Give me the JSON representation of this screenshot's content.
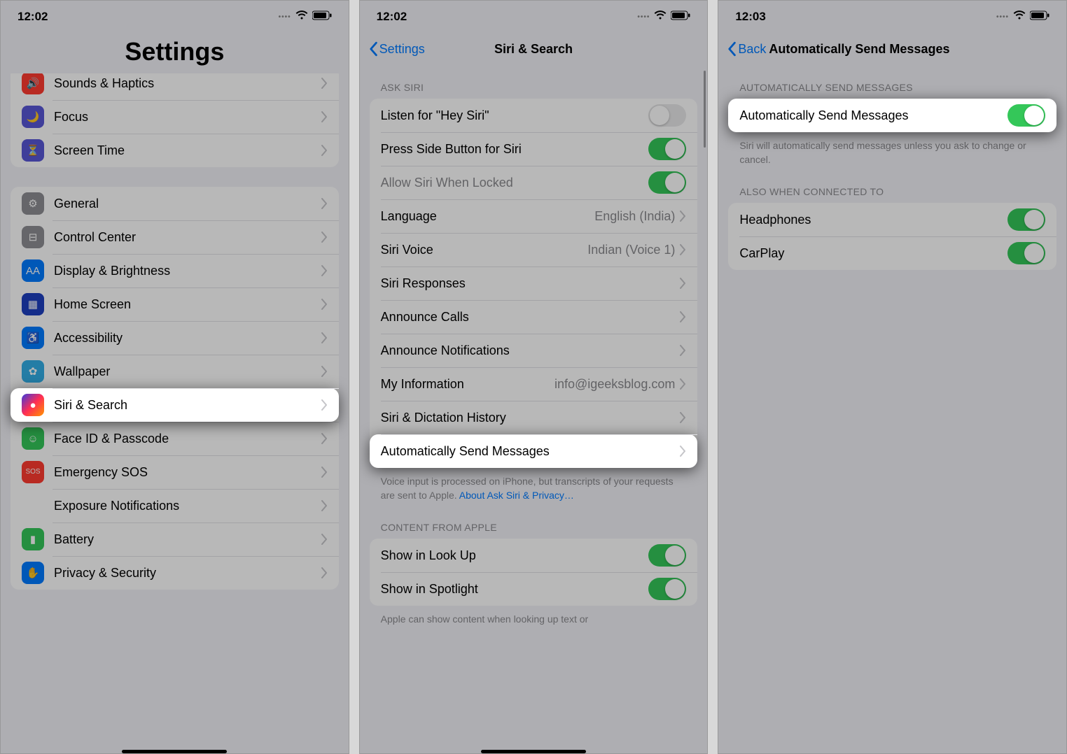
{
  "panel1": {
    "time": "12:02",
    "title": "Settings",
    "rows_g1": [
      {
        "label": "Sounds & Haptics",
        "icon": "sounds-icon",
        "bg": "bg-red",
        "glyph": "🔊"
      },
      {
        "label": "Focus",
        "icon": "focus-icon",
        "bg": "bg-indigo",
        "glyph": "🌙"
      },
      {
        "label": "Screen Time",
        "icon": "screentime-icon",
        "bg": "bg-indigo",
        "glyph": "⏳"
      }
    ],
    "rows_g2": [
      {
        "label": "General",
        "icon": "general-icon",
        "bg": "bg-gray",
        "glyph": "⚙"
      },
      {
        "label": "Control Center",
        "icon": "control-center-icon",
        "bg": "bg-gray",
        "glyph": "⊟"
      },
      {
        "label": "Display & Brightness",
        "icon": "display-icon",
        "bg": "bg-blue",
        "glyph": "AA"
      },
      {
        "label": "Home Screen",
        "icon": "home-screen-icon",
        "bg": "bg-darkblue",
        "glyph": "▦"
      },
      {
        "label": "Accessibility",
        "icon": "accessibility-icon",
        "bg": "bg-blue",
        "glyph": "♿"
      },
      {
        "label": "Wallpaper",
        "icon": "wallpaper-icon",
        "bg": "bg-cyan",
        "glyph": "✿"
      },
      {
        "label": "Siri & Search",
        "icon": "siri-icon",
        "bg": "bg-siri",
        "glyph": "●",
        "highlight": true
      },
      {
        "label": "Face ID & Passcode",
        "icon": "faceid-icon",
        "bg": "bg-green",
        "glyph": "☺"
      },
      {
        "label": "Emergency SOS",
        "icon": "sos-icon",
        "bg": "bg-red",
        "glyph": "SOS"
      },
      {
        "label": "Exposure Notifications",
        "icon": "exposure-icon",
        "bg": "bg-white-red",
        "glyph": "✺"
      },
      {
        "label": "Battery",
        "icon": "battery-icon",
        "bg": "bg-green",
        "glyph": "▮"
      },
      {
        "label": "Privacy & Security",
        "icon": "privacy-icon",
        "bg": "bg-blue",
        "glyph": "✋"
      }
    ]
  },
  "panel2": {
    "time": "12:02",
    "back": "Settings",
    "title": "Siri & Search",
    "section1": "ASK SIRI",
    "rows1": [
      {
        "label": "Listen for \"Hey Siri\"",
        "type": "toggle",
        "on": false
      },
      {
        "label": "Press Side Button for Siri",
        "type": "toggle",
        "on": true
      },
      {
        "label": "Allow Siri When Locked",
        "type": "toggle",
        "on": true,
        "disabled": true
      },
      {
        "label": "Language",
        "type": "nav",
        "value": "English (India)"
      },
      {
        "label": "Siri Voice",
        "type": "nav",
        "value": "Indian (Voice 1)"
      },
      {
        "label": "Siri Responses",
        "type": "nav"
      },
      {
        "label": "Announce Calls",
        "type": "nav"
      },
      {
        "label": "Announce Notifications",
        "type": "nav"
      },
      {
        "label": "My Information",
        "type": "nav",
        "value": "info@igeeksblog.com"
      },
      {
        "label": "Siri & Dictation History",
        "type": "nav"
      },
      {
        "label": "Automatically Send Messages",
        "type": "nav",
        "highlight": true
      }
    ],
    "footer1_a": "Voice input is processed on iPhone, but transcripts of your requests are sent to Apple. ",
    "footer1_link": "About Ask Siri & Privacy…",
    "section2": "CONTENT FROM APPLE",
    "rows2": [
      {
        "label": "Show in Look Up",
        "type": "toggle",
        "on": true
      },
      {
        "label": "Show in Spotlight",
        "type": "toggle",
        "on": true
      }
    ],
    "footer2": "Apple can show content when looking up text or"
  },
  "panel3": {
    "time": "12:03",
    "back": "Back",
    "title": "Automatically Send Messages",
    "section1": "AUTOMATICALLY SEND MESSAGES",
    "row_main": {
      "label": "Automatically Send Messages",
      "on": true
    },
    "footer1": "Siri will automatically send messages unless you ask to change or cancel.",
    "section2": "ALSO WHEN CONNECTED TO",
    "rows2": [
      {
        "label": "Headphones",
        "on": true
      },
      {
        "label": "CarPlay",
        "on": true
      }
    ]
  }
}
